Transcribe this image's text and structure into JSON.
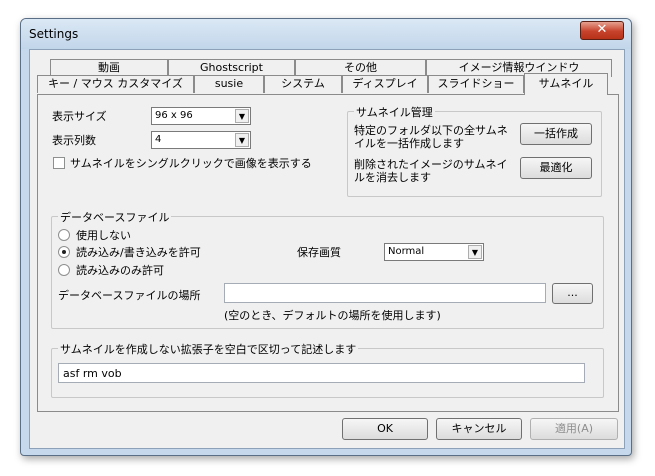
{
  "window": {
    "title": "Settings",
    "close_glyph": "✕"
  },
  "tabs": {
    "row1": [
      "動画",
      "Ghostscript",
      "その他",
      "イメージ情報ウインドウ"
    ],
    "row2": [
      "キー / マウス カスタマイズ",
      "susie",
      "システム",
      "ディスプレイ",
      "スライドショー",
      "サムネイル"
    ],
    "active": "サムネイル"
  },
  "thumbnail": {
    "size_label": "表示サイズ",
    "size_value": "96 x 96",
    "columns_label": "表示列数",
    "columns_value": "4",
    "single_click_label": "サムネイルをシングルクリックで画像を表示する",
    "single_click_checked": false
  },
  "thumb_manage": {
    "title": "サムネイル管理",
    "bulk_text": "特定のフォルダ以下の全サムネイルを一括作成します",
    "bulk_button": "一括作成",
    "clean_text": "削除されたイメージのサムネイルを消去します",
    "optimize_button": "最適化"
  },
  "database": {
    "title": "データベースファイル",
    "options": [
      "使用しない",
      "読み込み/書き込みを許可",
      "読み込みのみ許可"
    ],
    "selected_index": 1,
    "quality_label": "保存画質",
    "quality_value": "Normal",
    "location_label": "データベースファイルの場所",
    "location_value": "",
    "browse_button": "...",
    "location_hint": "(空のとき、デフォルトの場所を使用します)"
  },
  "extensions": {
    "title": "サムネイルを作成しない拡張子を空白で区切って記述します",
    "value": "asf rm vob"
  },
  "footer": {
    "ok": "OK",
    "cancel": "キャンセル",
    "apply": "適用(A)"
  },
  "icons": {
    "dropdown": "chevron-down-icon",
    "close": "close-icon"
  }
}
